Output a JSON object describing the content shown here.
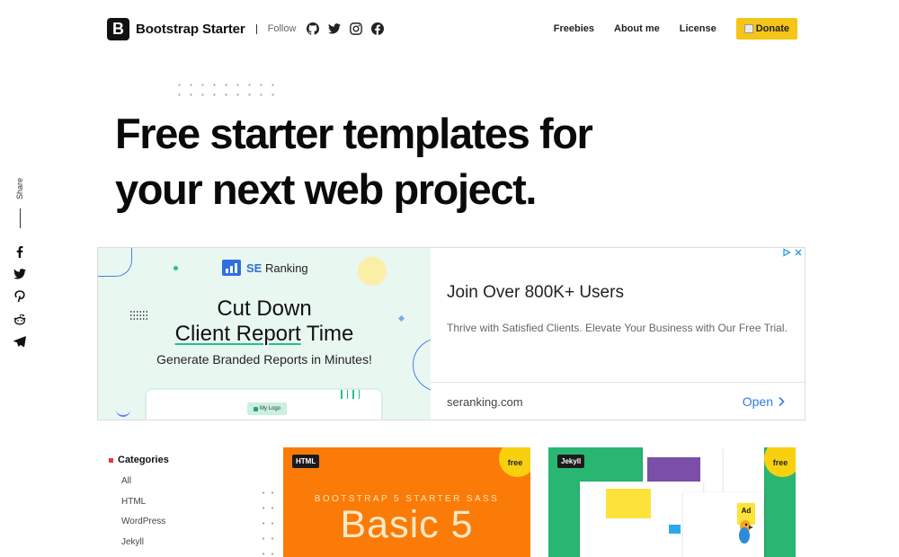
{
  "header": {
    "brand_letter": "B",
    "brand_name": "Bootstrap Starter",
    "follow_label": "Follow",
    "social_icons": [
      "github-icon",
      "twitter-icon",
      "instagram-icon",
      "facebook-icon"
    ],
    "nav": [
      {
        "label": "Freebies"
      },
      {
        "label": "About me"
      },
      {
        "label": "License"
      }
    ],
    "donate_label": "Donate"
  },
  "hero": {
    "line1": "Free starter templates for",
    "line2": "your next web project."
  },
  "share": {
    "label": "Share",
    "icons": [
      "facebook-icon",
      "twitter-icon",
      "pinterest-icon",
      "reddit-icon",
      "telegram-icon"
    ]
  },
  "ad": {
    "brand_prefix": "SE",
    "brand_suffix": " Ranking",
    "headline_line1": "Cut Down",
    "headline_underlined": "Client Report",
    "headline_rest": " Time",
    "subline": "Generate Branded Reports in Minutes!",
    "chip_label": "My Logo",
    "title": "Join Over 800K+ Users",
    "description": "Thrive with Satisfied Clients. Elevate Your Business with Our Free Trial.",
    "domain": "seranking.com",
    "cta": "Open"
  },
  "categories": {
    "title": "Categories",
    "items": [
      "All",
      "HTML",
      "WordPress",
      "Jekyll"
    ]
  },
  "cards": [
    {
      "tag": "HTML",
      "badge": "free",
      "subtitle": "BOOTSTRAP 5 STARTER SASS",
      "title": "Basic 5"
    },
    {
      "tag": "Jekyll",
      "badge": "free",
      "mock_ad": "Ad"
    }
  ],
  "colors": {
    "accent_yellow": "#f5c518",
    "card_orange": "#fb7b08",
    "card_green": "#29b673",
    "ad_blue": "#2f7ae5"
  }
}
